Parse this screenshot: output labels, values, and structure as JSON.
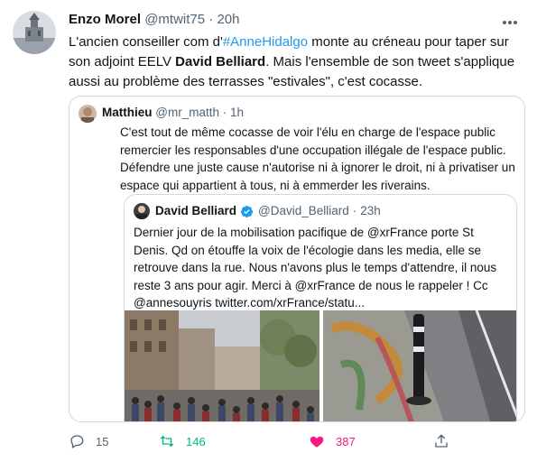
{
  "author": {
    "name": "Enzo Morel",
    "handle": "@mtwit75",
    "separator": "·",
    "time": "20h"
  },
  "tweet": {
    "segments": {
      "t1": "L'ancien conseiller com d'",
      "hashtag": "#AnneHidalgo",
      "t2": " monte au créneau pour taper sur son adjoint EELV ",
      "bold": "David Belliard",
      "t3": ". Mais l'ensemble de son tweet s'applique aussi au problème des terrasses \"estivales\", c'est cocasse."
    }
  },
  "quoted": {
    "name": "Matthieu",
    "handle": "@mr_matth",
    "separator": "·",
    "time": "1h",
    "text": "C'est tout de même cocasse de voir l'élu en charge de l'espace public remercier les responsables d'une occupation illégale de l'espace public. Défendre une juste cause n'autorise ni à ignorer le droit, ni à privatiser un espace qui appartient à tous, ni à emmerder les riverains."
  },
  "nested_quote": {
    "name": "David Belliard",
    "handle": "@David_Belliard",
    "separator": "·",
    "time": "23h",
    "text": "Dernier jour de la mobilisation pacifique de @xrFrance porte St Denis. Qd on étouffe la voix de l'écologie dans les media, elle se retrouve dans la rue. Nous n'avons plus le temps d'attendre, il nous reste 3 ans pour agir. Merci à @xrFrance de nous le rappeler ! Cc @annesouyris twitter.com/xrFrance/statu..."
  },
  "actions": {
    "replies": "15",
    "retweets": "146",
    "likes": "387"
  },
  "icons": {
    "more": "more-dots-icon",
    "reply": "reply-bubble-icon",
    "retweet": "retweet-icon",
    "like": "heart-filled-icon",
    "share": "share-upload-icon",
    "verified": "verified-badge-icon"
  },
  "colors": {
    "link": "#1d9bf0",
    "muted": "#536471",
    "retweet": "#00ba7c",
    "like": "#f91880",
    "border": "#cfd9de"
  }
}
